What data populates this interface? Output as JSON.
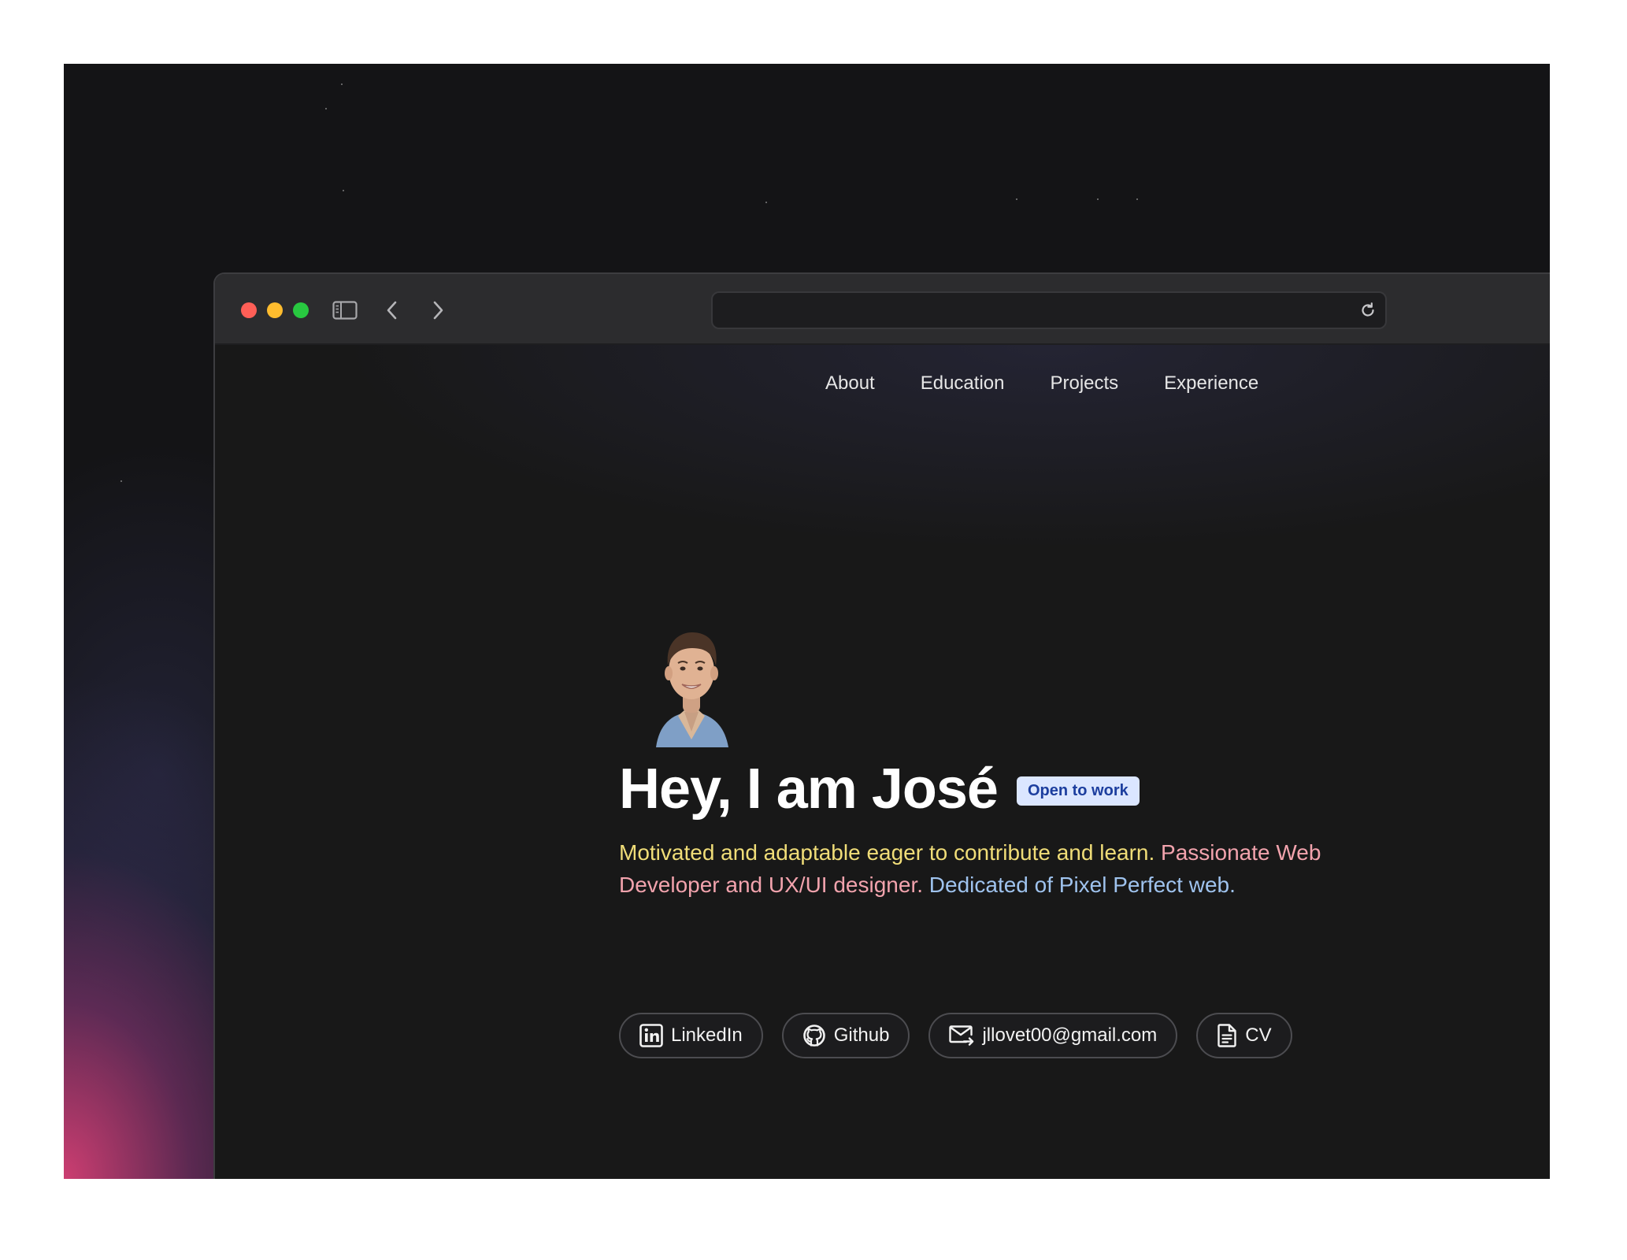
{
  "nav": {
    "items": [
      {
        "label": "About"
      },
      {
        "label": "Education"
      },
      {
        "label": "Projects"
      },
      {
        "label": "Experience"
      }
    ]
  },
  "hero": {
    "title": "Hey, I am José",
    "badge": "Open to work",
    "intro": {
      "part1": "Motivated and adaptable eager to contribute and learn.",
      "part2": "Passionate Web Developer and UX/UI designer.",
      "part3": "Dedicated of Pixel Perfect web."
    }
  },
  "links": {
    "linkedin": "LinkedIn",
    "github": "Github",
    "email": "jllovet00@gmail.com",
    "cv": "CV"
  },
  "colors": {
    "intro_yellow": "#f0dd78",
    "intro_pink": "#f2a3ad",
    "intro_blue": "#9fc3ee",
    "badge_bg": "#dbe6ff",
    "badge_text": "#1c3e9e"
  }
}
